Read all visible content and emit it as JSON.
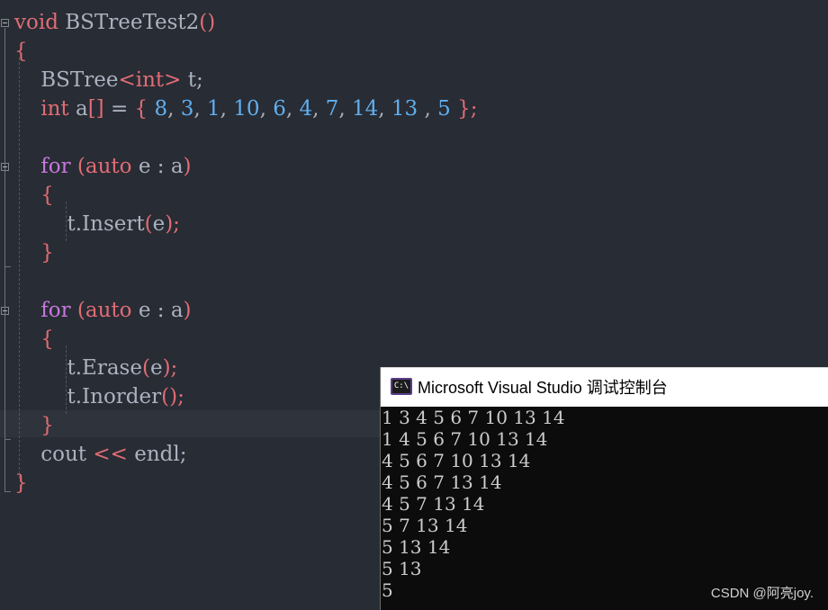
{
  "editor": {
    "lines": [
      [
        {
          "t": "void",
          "c": "kw-red"
        },
        {
          "t": " BSTreeTest2",
          "c": "plain"
        },
        {
          "t": "()",
          "c": "paren"
        }
      ],
      [
        {
          "t": "{",
          "c": "brace"
        }
      ],
      [
        {
          "t": "    BSTree",
          "c": "plain"
        },
        {
          "t": "<int>",
          "c": "kw-red"
        },
        {
          "t": " t;",
          "c": "plain"
        }
      ],
      [
        {
          "t": "    int",
          "c": "kw-red"
        },
        {
          "t": " a",
          "c": "plain"
        },
        {
          "t": "[]",
          "c": "paren"
        },
        {
          "t": " = ",
          "c": "plain"
        },
        {
          "t": "{",
          "c": "brace"
        },
        {
          "t": " 8",
          "c": "num"
        },
        {
          "t": ", ",
          "c": "plain"
        },
        {
          "t": "3",
          "c": "num"
        },
        {
          "t": ", ",
          "c": "plain"
        },
        {
          "t": "1",
          "c": "num"
        },
        {
          "t": ", ",
          "c": "plain"
        },
        {
          "t": "10",
          "c": "num"
        },
        {
          "t": ", ",
          "c": "plain"
        },
        {
          "t": "6",
          "c": "num"
        },
        {
          "t": ", ",
          "c": "plain"
        },
        {
          "t": "4",
          "c": "num"
        },
        {
          "t": ", ",
          "c": "plain"
        },
        {
          "t": "7",
          "c": "num"
        },
        {
          "t": ", ",
          "c": "plain"
        },
        {
          "t": "14",
          "c": "num"
        },
        {
          "t": ", ",
          "c": "plain"
        },
        {
          "t": "13",
          "c": "num"
        },
        {
          "t": " , ",
          "c": "plain"
        },
        {
          "t": "5",
          "c": "num"
        },
        {
          "t": " ",
          "c": "plain"
        },
        {
          "t": "};",
          "c": "brace"
        }
      ],
      [],
      [
        {
          "t": "    for",
          "c": "kw-purple"
        },
        {
          "t": " (",
          "c": "paren"
        },
        {
          "t": "auto",
          "c": "kw-red"
        },
        {
          "t": " e : a",
          "c": "plain"
        },
        {
          "t": ")",
          "c": "paren"
        }
      ],
      [
        {
          "t": "    {",
          "c": "brace"
        }
      ],
      [
        {
          "t": "        t.Insert",
          "c": "plain"
        },
        {
          "t": "(",
          "c": "paren"
        },
        {
          "t": "e",
          "c": "plain"
        },
        {
          "t": ");",
          "c": "paren"
        }
      ],
      [
        {
          "t": "    }",
          "c": "brace"
        }
      ],
      [],
      [
        {
          "t": "    for",
          "c": "kw-purple"
        },
        {
          "t": " (",
          "c": "paren"
        },
        {
          "t": "auto",
          "c": "kw-red"
        },
        {
          "t": " e : a",
          "c": "plain"
        },
        {
          "t": ")",
          "c": "paren"
        }
      ],
      [
        {
          "t": "    {",
          "c": "brace"
        }
      ],
      [
        {
          "t": "        t.Erase",
          "c": "plain"
        },
        {
          "t": "(",
          "c": "paren"
        },
        {
          "t": "e",
          "c": "plain"
        },
        {
          "t": ");",
          "c": "paren"
        }
      ],
      [
        {
          "t": "        t.Inorder",
          "c": "plain"
        },
        {
          "t": "();",
          "c": "paren"
        }
      ],
      [
        {
          "t": "    }",
          "c": "brace"
        }
      ],
      [
        {
          "t": "    cout ",
          "c": "plain"
        },
        {
          "t": "<<",
          "c": "kw-red"
        },
        {
          "t": " endl;",
          "c": "plain"
        }
      ],
      [
        {
          "t": "}",
          "c": "brace"
        }
      ]
    ]
  },
  "console": {
    "icon_label": "C:\\",
    "title": "Microsoft Visual Studio 调试控制台",
    "output": [
      "1 3 4 5 6 7 10 13 14",
      "1 4 5 6 7 10 13 14",
      "4 5 6 7 10 13 14",
      "4 5 6 7 13 14",
      "4 5 7 13 14",
      "5 7 13 14",
      "5 13 14",
      "5 13",
      "5"
    ]
  },
  "watermark": "CSDN @阿亮joy.",
  "colors": {
    "background": "#282c34",
    "keyword_red": "#e06c75",
    "keyword_purple": "#c678dd",
    "number_blue": "#61afef",
    "console_bg": "#0c0c0c"
  }
}
